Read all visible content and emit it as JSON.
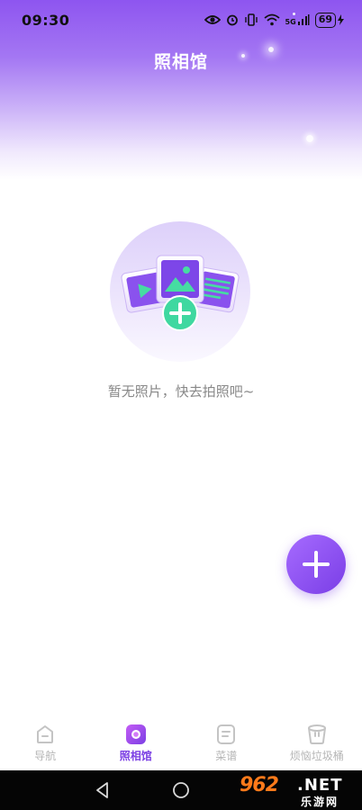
{
  "status_bar": {
    "time": "09:30",
    "network": "5G",
    "battery": "69"
  },
  "header": {
    "title": "照相馆"
  },
  "empty_state": {
    "message": "暂无照片，快去拍照吧~"
  },
  "tabs": [
    {
      "label": "导航",
      "icon": "home-icon",
      "active": false
    },
    {
      "label": "照相馆",
      "icon": "camera-icon",
      "active": true
    },
    {
      "label": "菜谱",
      "icon": "note-icon",
      "active": false
    },
    {
      "label": "烦恼垃圾桶",
      "icon": "trash-bin-icon",
      "active": false
    }
  ],
  "watermark": {
    "brand": "962",
    "suffix": ".NET",
    "cn": "乐游网"
  },
  "colors": {
    "accent": "#7b3fe4",
    "header_top": "#8e55f0",
    "fab": "#8d52f2",
    "plus_green": "#3fd8a0",
    "inactive": "#b5b5b5"
  }
}
